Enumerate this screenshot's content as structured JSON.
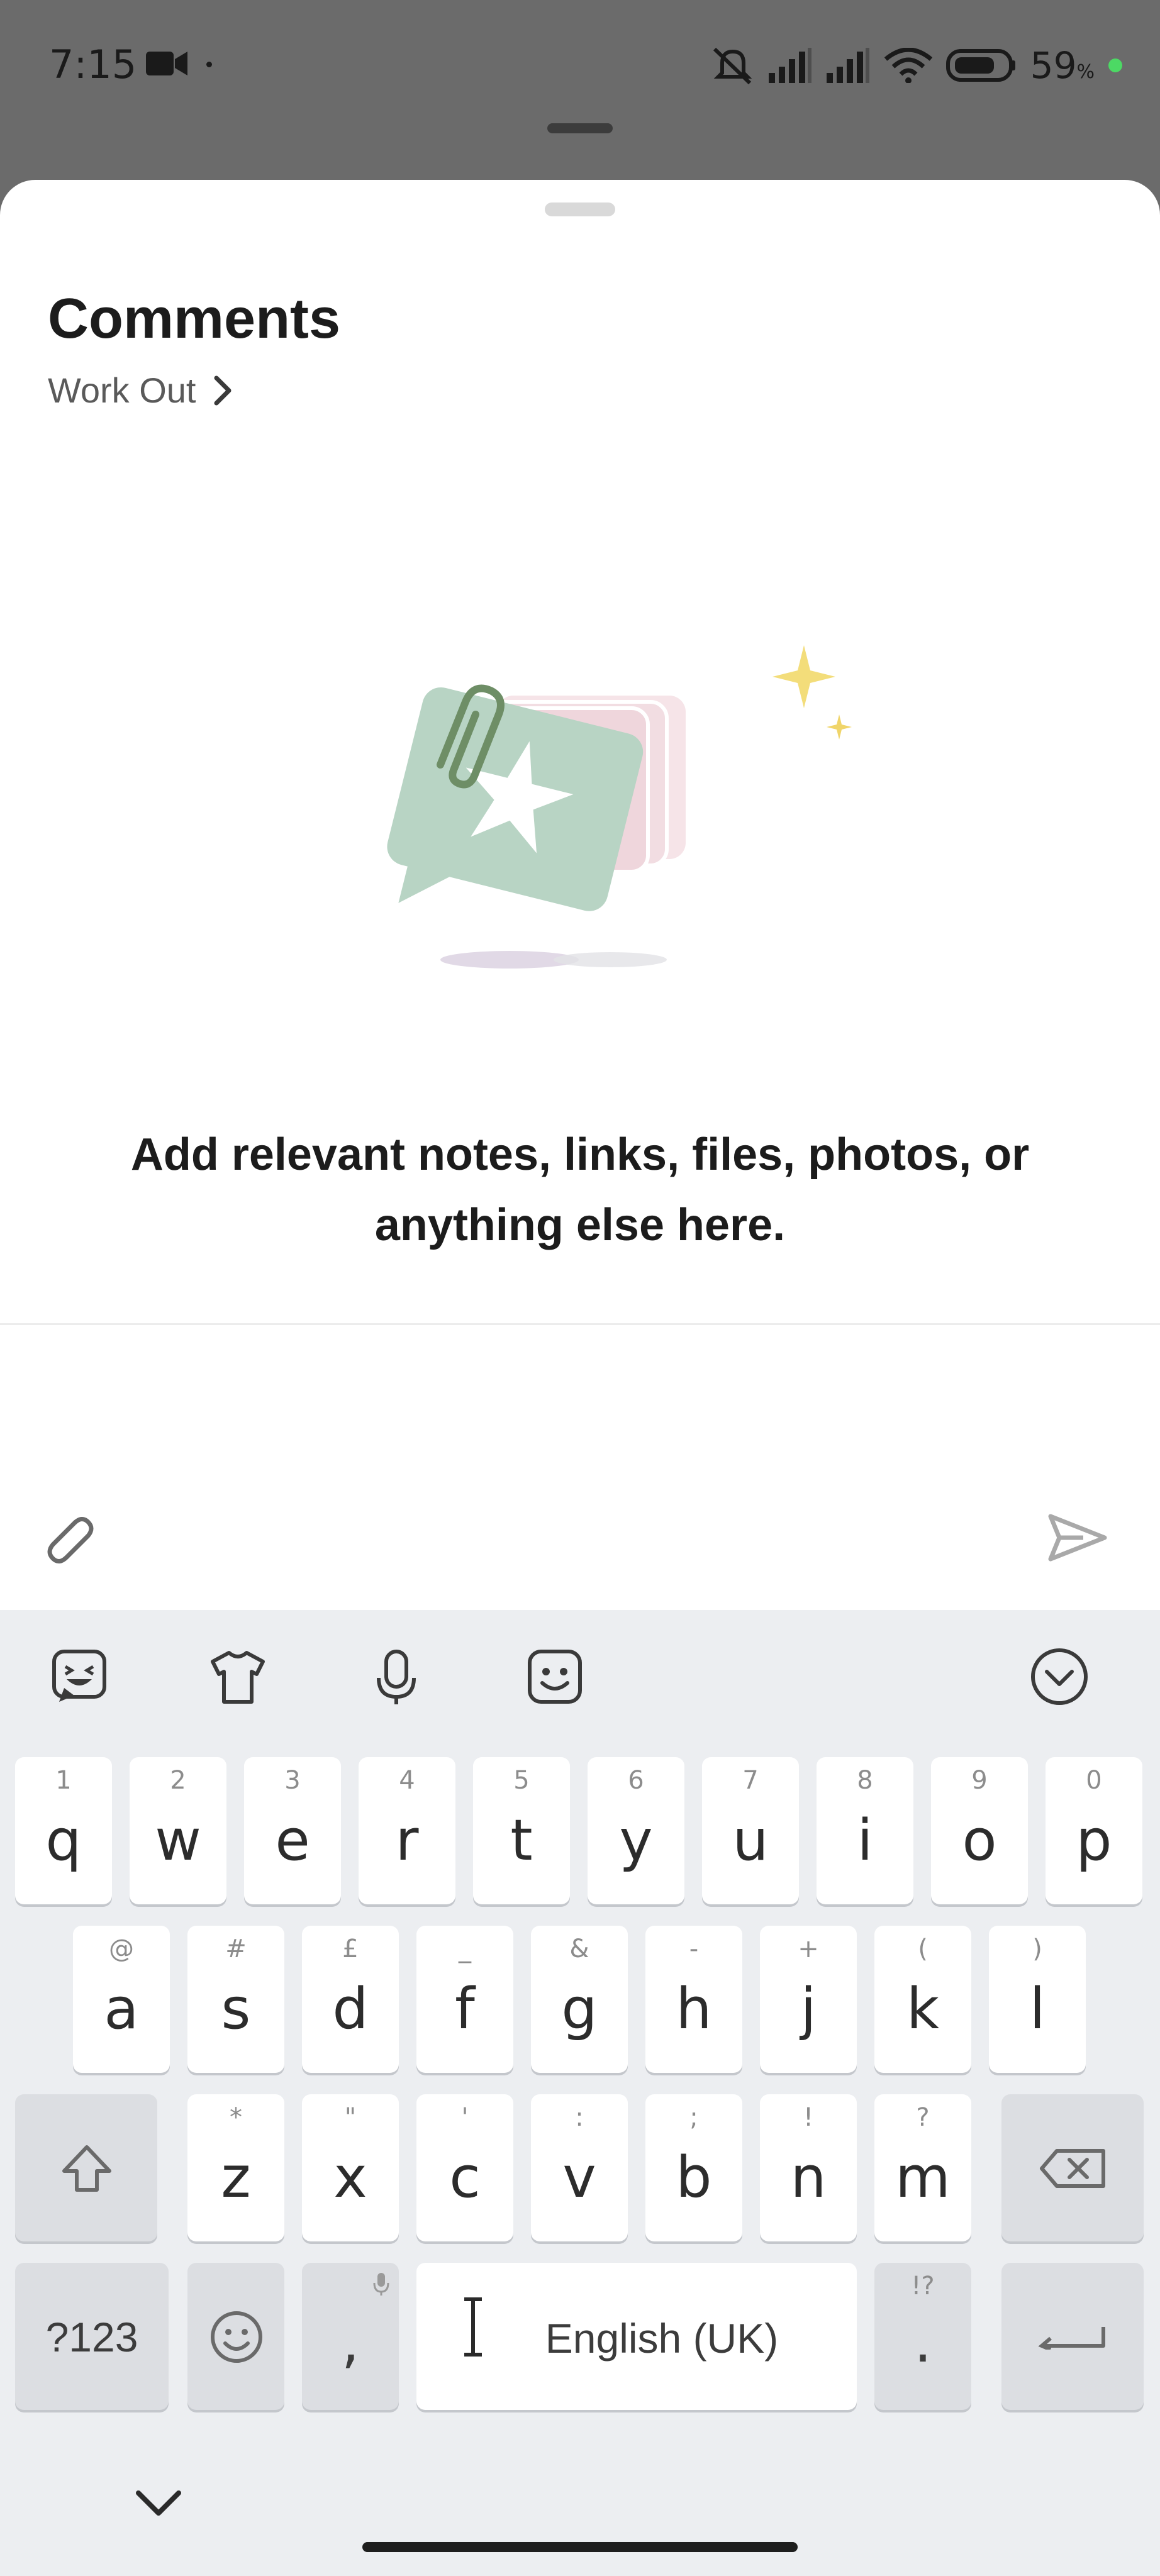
{
  "status_bar": {
    "time": "7:15",
    "battery_percent": "59",
    "battery_unit": "%",
    "icons": [
      "video-camera-icon",
      "mute-icon",
      "signal-icon",
      "signal-icon",
      "wifi-icon",
      "battery-icon",
      "privacy-indicator-dot"
    ]
  },
  "sheet": {
    "title": "Comments",
    "breadcrumb": "Work Out",
    "empty_message": "Add relevant notes, links, files, photos, or anything else here.",
    "illustration": "comment-cards-illustration",
    "input_value": ""
  },
  "keyboard": {
    "toolbar_icons": [
      "sticker-icon",
      "theme-shirt-icon",
      "microphone-icon",
      "emoji-face-icon",
      "collapse-chevron-icon"
    ],
    "row1": [
      {
        "key": "q",
        "hint": "1"
      },
      {
        "key": "w",
        "hint": "2"
      },
      {
        "key": "e",
        "hint": "3"
      },
      {
        "key": "r",
        "hint": "4"
      },
      {
        "key": "t",
        "hint": "5"
      },
      {
        "key": "y",
        "hint": "6"
      },
      {
        "key": "u",
        "hint": "7"
      },
      {
        "key": "i",
        "hint": "8"
      },
      {
        "key": "o",
        "hint": "9"
      },
      {
        "key": "p",
        "hint": "0"
      }
    ],
    "row2": [
      {
        "key": "a",
        "hint": "@"
      },
      {
        "key": "s",
        "hint": "#"
      },
      {
        "key": "d",
        "hint": "£"
      },
      {
        "key": "f",
        "hint": "_"
      },
      {
        "key": "g",
        "hint": "&"
      },
      {
        "key": "h",
        "hint": "-"
      },
      {
        "key": "j",
        "hint": "+"
      },
      {
        "key": "k",
        "hint": "("
      },
      {
        "key": "l",
        "hint": ")"
      }
    ],
    "row3": [
      {
        "key": "z",
        "hint": "*"
      },
      {
        "key": "x",
        "hint": "\""
      },
      {
        "key": "c",
        "hint": "'"
      },
      {
        "key": "v",
        "hint": ":"
      },
      {
        "key": "b",
        "hint": ";"
      },
      {
        "key": "n",
        "hint": "!"
      },
      {
        "key": "m",
        "hint": "?"
      }
    ],
    "symbols_label": "?123",
    "comma": ",",
    "space_label": "English (UK)",
    "period": ".",
    "period_hint": "!?"
  }
}
